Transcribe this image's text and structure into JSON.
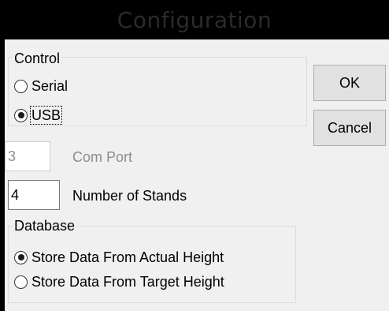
{
  "window": {
    "title": "Configuration"
  },
  "control_group": {
    "legend": "Control",
    "options": [
      {
        "label": "Serial",
        "checked": false
      },
      {
        "label": "USB",
        "checked": true
      }
    ]
  },
  "buttons": {
    "ok_label": "OK",
    "cancel_label": "Cancel"
  },
  "com_port": {
    "value": "3",
    "label": "Com Port",
    "enabled": false
  },
  "stands": {
    "value": "4",
    "label": "Number of Stands"
  },
  "database_group": {
    "legend": "Database",
    "options": [
      {
        "label": "Store Data From Actual Height",
        "checked": true
      },
      {
        "label": "Store Data From Target Height",
        "checked": false
      }
    ]
  }
}
